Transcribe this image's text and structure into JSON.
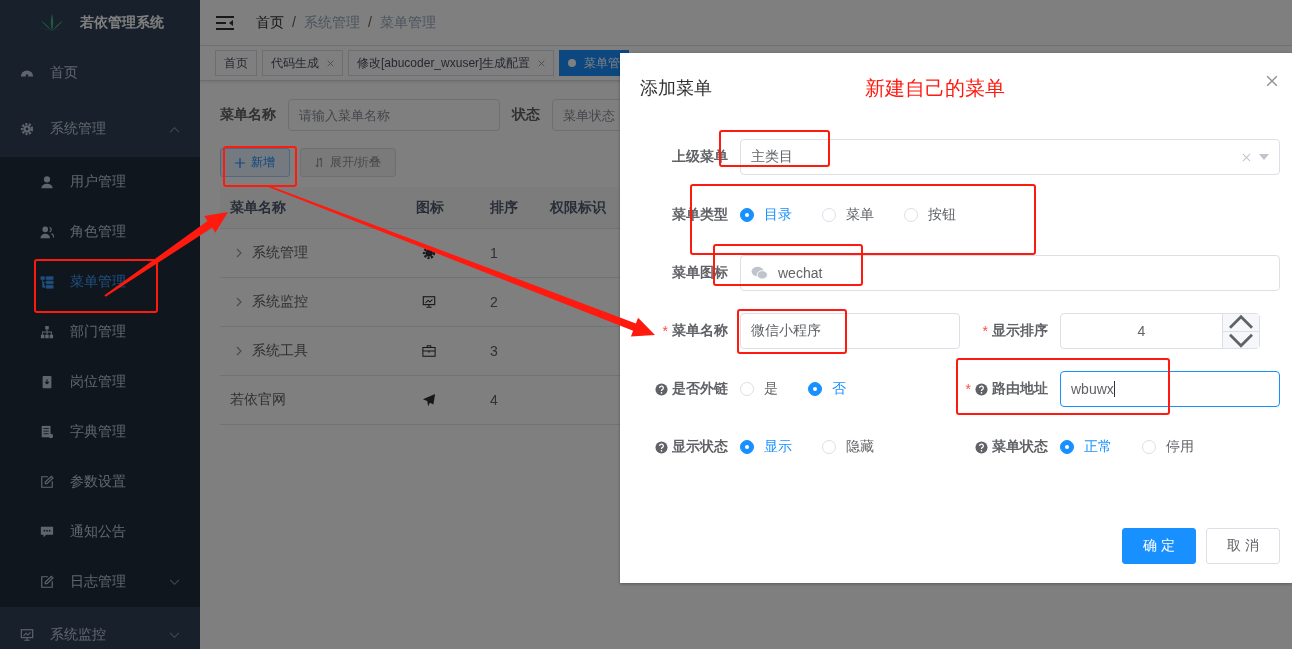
{
  "sidebar": {
    "title": "若依管理系统",
    "items": [
      {
        "label": "首页",
        "selected": false
      },
      {
        "label": "系统管理",
        "selected": false,
        "expanded": true,
        "children": [
          {
            "label": "用户管理",
            "selected": false
          },
          {
            "label": "角色管理",
            "selected": false
          },
          {
            "label": "菜单管理",
            "selected": true
          },
          {
            "label": "部门管理",
            "selected": false
          },
          {
            "label": "岗位管理",
            "selected": false
          },
          {
            "label": "字典管理",
            "selected": false
          },
          {
            "label": "参数设置",
            "selected": false
          },
          {
            "label": "通知公告",
            "selected": false
          },
          {
            "label": "日志管理",
            "selected": false,
            "expanded": false
          }
        ]
      },
      {
        "label": "系统监控",
        "selected": false,
        "expanded": false
      }
    ]
  },
  "breadcrumb": {
    "separator": "/",
    "items": [
      "首页",
      "系统管理",
      "菜单管理"
    ]
  },
  "tags": [
    {
      "label": "首页",
      "selected": false,
      "closable": false
    },
    {
      "label": "代码生成",
      "selected": false,
      "closable": true
    },
    {
      "label": "修改[abucoder_wxuser]生成配置",
      "selected": false,
      "closable": true
    },
    {
      "label": "菜单管",
      "selected": true,
      "closable": false
    }
  ],
  "search": [
    {
      "label": "菜单名称",
      "placeholder": "请输入菜单名称"
    },
    {
      "label": "状态",
      "placeholder": "菜单状态"
    }
  ],
  "toolbar": [
    {
      "label": "新增",
      "kind": "primary"
    },
    {
      "label": "展开/折叠",
      "kind": "default"
    }
  ],
  "table": {
    "columns": [
      "菜单名称",
      "图标",
      "排序",
      "权限标识"
    ],
    "rows": [
      {
        "name": "系统管理",
        "sort": "1",
        "expandable": true
      },
      {
        "name": "系统监控",
        "sort": "2",
        "expandable": true
      },
      {
        "name": "系统工具",
        "sort": "3",
        "expandable": true
      },
      {
        "name": "若依官网",
        "sort": "4",
        "expandable": false
      }
    ]
  },
  "dialog": {
    "title": "添加菜单",
    "note": "新建自己的菜单",
    "rows": [
      [
        {
          "kind": "select",
          "label": "上级菜单",
          "value": "主类目"
        }
      ],
      [
        {
          "kind": "radio",
          "label": "菜单类型",
          "options": [
            {
              "label": "目录",
              "selected": true
            },
            {
              "label": "菜单",
              "selected": false
            },
            {
              "label": "按钮",
              "selected": false
            }
          ]
        }
      ],
      [
        {
          "kind": "icon-input",
          "label": "菜单图标",
          "value": "wechat"
        }
      ],
      [
        {
          "kind": "input",
          "label": "菜单名称",
          "marker": "*",
          "value": "微信小程序",
          "focused": false
        },
        {
          "kind": "number",
          "label": "显示排序",
          "marker": "*",
          "value": "4"
        }
      ],
      [
        {
          "kind": "radio",
          "label": "是否外链",
          "help": true,
          "options": [
            {
              "label": "是",
              "selected": false
            },
            {
              "label": "否",
              "selected": true
            }
          ]
        },
        {
          "kind": "input",
          "label": "路由地址",
          "marker": "*",
          "help": true,
          "value": "wbuwx",
          "focused": true
        }
      ],
      [
        {
          "kind": "radio",
          "label": "显示状态",
          "help": true,
          "options": [
            {
              "label": "显示",
              "selected": true
            },
            {
              "label": "隐藏",
              "selected": false
            }
          ]
        },
        {
          "kind": "radio",
          "label": "菜单状态",
          "help": true,
          "options": [
            {
              "label": "正常",
              "selected": true
            },
            {
              "label": "停用",
              "selected": false
            }
          ]
        }
      ]
    ],
    "buttons": [
      {
        "label": "确 定",
        "kind": "primary"
      },
      {
        "label": "取 消",
        "kind": "default"
      }
    ]
  }
}
